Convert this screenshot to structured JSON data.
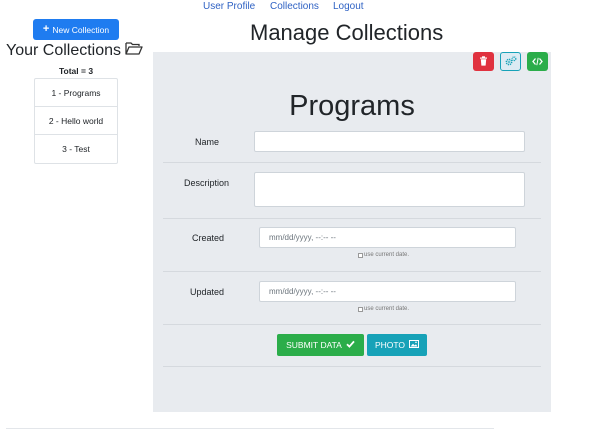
{
  "nav": {
    "user_profile": "User Profile",
    "collections": "Collections",
    "logout": "Logout"
  },
  "sidebar": {
    "new_collection_label": "New Collection",
    "title": "Your Collections",
    "total": "Total = 3",
    "items": [
      {
        "label": "1 - Programs"
      },
      {
        "label": "2 - Hello world"
      },
      {
        "label": "3 - Test"
      }
    ]
  },
  "main": {
    "title": "Manage Collections",
    "collection_name": "Programs",
    "form": {
      "name_label": "Name",
      "name_value": "",
      "description_label": "Description",
      "description_value": "",
      "created_label": "Created",
      "created_placeholder": "mm/dd/yyyy, --:-- --",
      "created_checkbox_label": "use current date.",
      "updated_label": "Updated",
      "updated_placeholder": "mm/dd/yyyy, --:-- --",
      "updated_checkbox_label": "use current date."
    },
    "submit_label": "SUBMIT DATA",
    "photo_label": "PHOTO"
  },
  "colors": {
    "primary": "#1f7cf0",
    "danger": "#e0323f",
    "success": "#2bad4a",
    "info": "#17a2b8",
    "panel_bg": "#e8ebef",
    "link": "#2f62c4"
  },
  "icons": {
    "new_collection": "plus-icon",
    "your_collections": "folder-open-icon",
    "delete": "trash-icon",
    "settings": "cogs-icon",
    "code": "code-icon",
    "submit": "check-icon",
    "photo": "image-icon"
  }
}
